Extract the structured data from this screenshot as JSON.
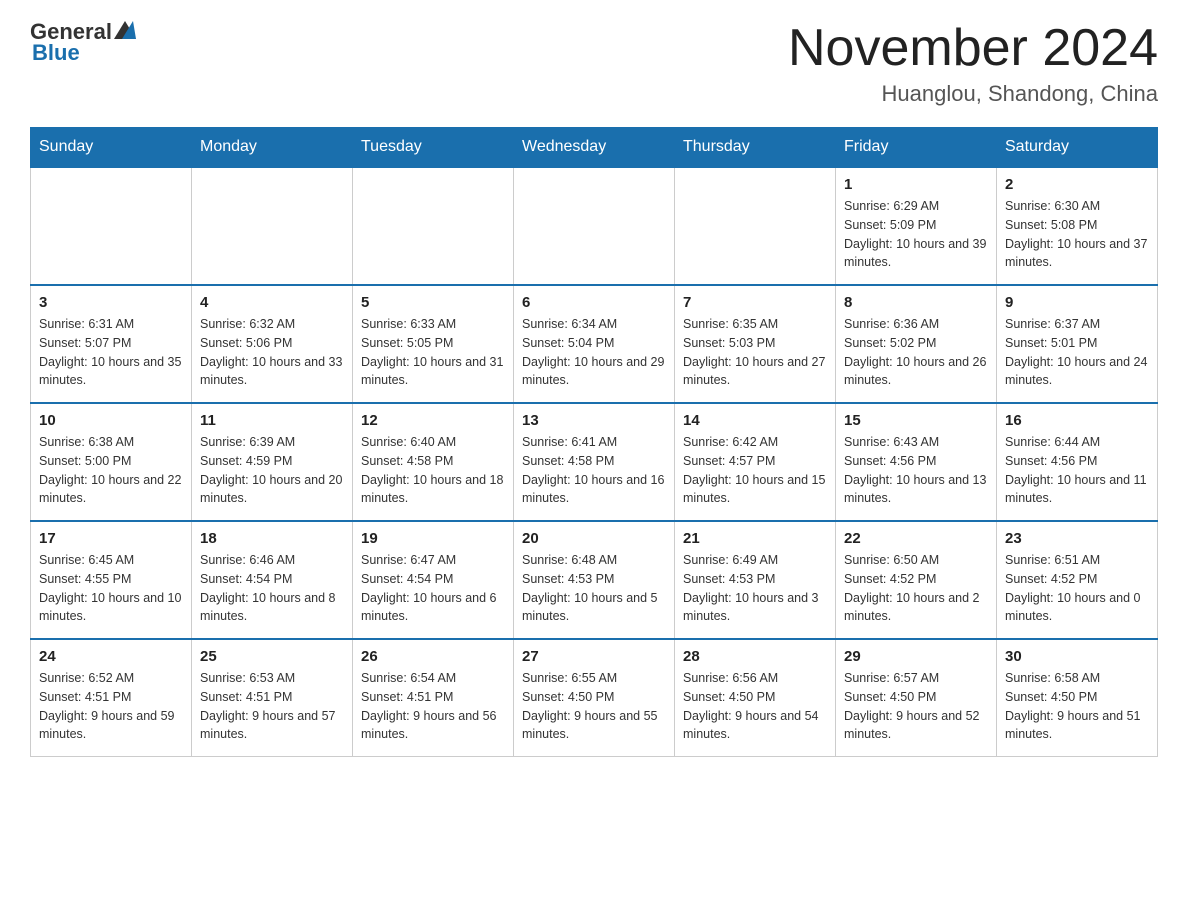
{
  "header": {
    "logo_general": "General",
    "logo_blue": "Blue",
    "month_year": "November 2024",
    "location": "Huanglou, Shandong, China"
  },
  "days_of_week": [
    "Sunday",
    "Monday",
    "Tuesday",
    "Wednesday",
    "Thursday",
    "Friday",
    "Saturday"
  ],
  "weeks": [
    [
      {
        "day": "",
        "info": ""
      },
      {
        "day": "",
        "info": ""
      },
      {
        "day": "",
        "info": ""
      },
      {
        "day": "",
        "info": ""
      },
      {
        "day": "",
        "info": ""
      },
      {
        "day": "1",
        "info": "Sunrise: 6:29 AM\nSunset: 5:09 PM\nDaylight: 10 hours and 39 minutes."
      },
      {
        "day": "2",
        "info": "Sunrise: 6:30 AM\nSunset: 5:08 PM\nDaylight: 10 hours and 37 minutes."
      }
    ],
    [
      {
        "day": "3",
        "info": "Sunrise: 6:31 AM\nSunset: 5:07 PM\nDaylight: 10 hours and 35 minutes."
      },
      {
        "day": "4",
        "info": "Sunrise: 6:32 AM\nSunset: 5:06 PM\nDaylight: 10 hours and 33 minutes."
      },
      {
        "day": "5",
        "info": "Sunrise: 6:33 AM\nSunset: 5:05 PM\nDaylight: 10 hours and 31 minutes."
      },
      {
        "day": "6",
        "info": "Sunrise: 6:34 AM\nSunset: 5:04 PM\nDaylight: 10 hours and 29 minutes."
      },
      {
        "day": "7",
        "info": "Sunrise: 6:35 AM\nSunset: 5:03 PM\nDaylight: 10 hours and 27 minutes."
      },
      {
        "day": "8",
        "info": "Sunrise: 6:36 AM\nSunset: 5:02 PM\nDaylight: 10 hours and 26 minutes."
      },
      {
        "day": "9",
        "info": "Sunrise: 6:37 AM\nSunset: 5:01 PM\nDaylight: 10 hours and 24 minutes."
      }
    ],
    [
      {
        "day": "10",
        "info": "Sunrise: 6:38 AM\nSunset: 5:00 PM\nDaylight: 10 hours and 22 minutes."
      },
      {
        "day": "11",
        "info": "Sunrise: 6:39 AM\nSunset: 4:59 PM\nDaylight: 10 hours and 20 minutes."
      },
      {
        "day": "12",
        "info": "Sunrise: 6:40 AM\nSunset: 4:58 PM\nDaylight: 10 hours and 18 minutes."
      },
      {
        "day": "13",
        "info": "Sunrise: 6:41 AM\nSunset: 4:58 PM\nDaylight: 10 hours and 16 minutes."
      },
      {
        "day": "14",
        "info": "Sunrise: 6:42 AM\nSunset: 4:57 PM\nDaylight: 10 hours and 15 minutes."
      },
      {
        "day": "15",
        "info": "Sunrise: 6:43 AM\nSunset: 4:56 PM\nDaylight: 10 hours and 13 minutes."
      },
      {
        "day": "16",
        "info": "Sunrise: 6:44 AM\nSunset: 4:56 PM\nDaylight: 10 hours and 11 minutes."
      }
    ],
    [
      {
        "day": "17",
        "info": "Sunrise: 6:45 AM\nSunset: 4:55 PM\nDaylight: 10 hours and 10 minutes."
      },
      {
        "day": "18",
        "info": "Sunrise: 6:46 AM\nSunset: 4:54 PM\nDaylight: 10 hours and 8 minutes."
      },
      {
        "day": "19",
        "info": "Sunrise: 6:47 AM\nSunset: 4:54 PM\nDaylight: 10 hours and 6 minutes."
      },
      {
        "day": "20",
        "info": "Sunrise: 6:48 AM\nSunset: 4:53 PM\nDaylight: 10 hours and 5 minutes."
      },
      {
        "day": "21",
        "info": "Sunrise: 6:49 AM\nSunset: 4:53 PM\nDaylight: 10 hours and 3 minutes."
      },
      {
        "day": "22",
        "info": "Sunrise: 6:50 AM\nSunset: 4:52 PM\nDaylight: 10 hours and 2 minutes."
      },
      {
        "day": "23",
        "info": "Sunrise: 6:51 AM\nSunset: 4:52 PM\nDaylight: 10 hours and 0 minutes."
      }
    ],
    [
      {
        "day": "24",
        "info": "Sunrise: 6:52 AM\nSunset: 4:51 PM\nDaylight: 9 hours and 59 minutes."
      },
      {
        "day": "25",
        "info": "Sunrise: 6:53 AM\nSunset: 4:51 PM\nDaylight: 9 hours and 57 minutes."
      },
      {
        "day": "26",
        "info": "Sunrise: 6:54 AM\nSunset: 4:51 PM\nDaylight: 9 hours and 56 minutes."
      },
      {
        "day": "27",
        "info": "Sunrise: 6:55 AM\nSunset: 4:50 PM\nDaylight: 9 hours and 55 minutes."
      },
      {
        "day": "28",
        "info": "Sunrise: 6:56 AM\nSunset: 4:50 PM\nDaylight: 9 hours and 54 minutes."
      },
      {
        "day": "29",
        "info": "Sunrise: 6:57 AM\nSunset: 4:50 PM\nDaylight: 9 hours and 52 minutes."
      },
      {
        "day": "30",
        "info": "Sunrise: 6:58 AM\nSunset: 4:50 PM\nDaylight: 9 hours and 51 minutes."
      }
    ]
  ]
}
